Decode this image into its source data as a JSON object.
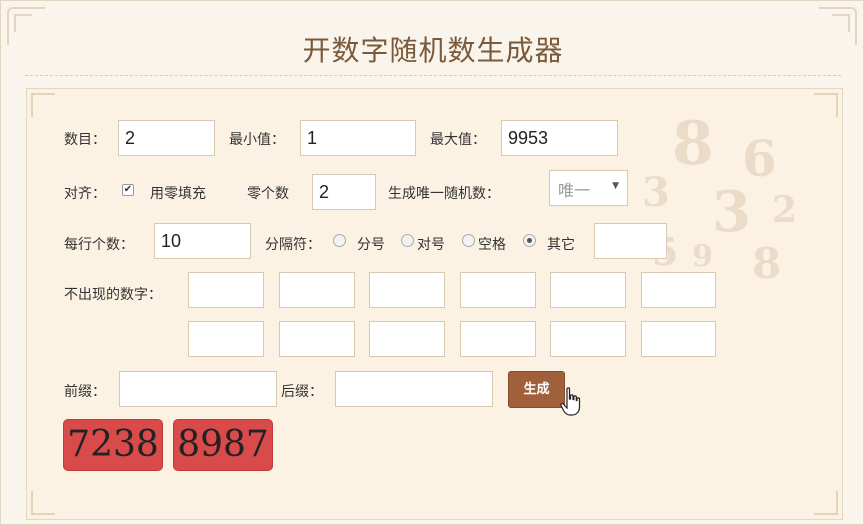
{
  "app": {
    "title": "开数字随机数生成器"
  },
  "form": {
    "count_label": "数目：",
    "count_value": "2",
    "min_label": "最小值：",
    "min_value": "1",
    "max_label": "最大值：",
    "max_value": "9953",
    "align_label": "对齐：",
    "zero_fill_label": "用零填充",
    "zero_fill_checked": true,
    "zero_count_label": "零个数",
    "zero_count_value": "2",
    "unique_label": "生成唯一随机数：",
    "unique_value": "唯一",
    "per_row_label": "每行个数：",
    "per_row_value": "10",
    "separator_label": "分隔符：",
    "separator_options": [
      "分号",
      "对号",
      "空格",
      "其它"
    ],
    "separator_selected": "其它",
    "separator_custom_value": "",
    "exclude_label": "不出现的数字：",
    "prefix_label": "前缀：",
    "prefix_value": "",
    "suffix_label": "后缀：",
    "suffix_value": "",
    "generate_label": "生成"
  },
  "results": [
    "7238",
    "8987"
  ],
  "colors": {
    "accent": "#a0603c",
    "result_bg": "#d94a4a",
    "title": "#7a5a3a"
  }
}
